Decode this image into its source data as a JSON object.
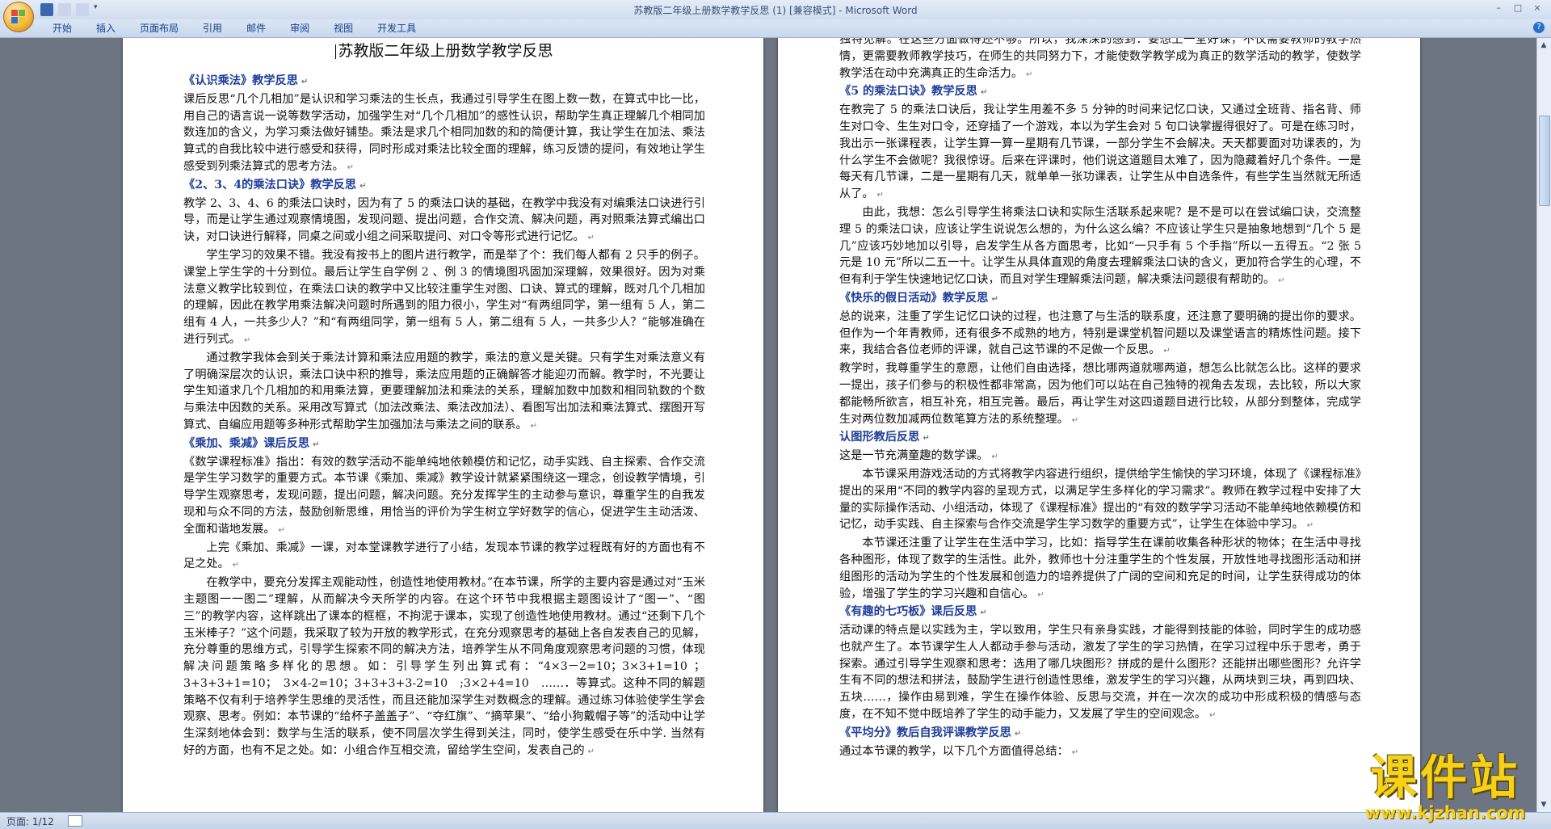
{
  "window": {
    "title": "苏教版二年级上册数学教学反思 (1) [兼容模式] - Microsoft Word",
    "controls": [
      "–",
      "□",
      "×"
    ]
  },
  "ribbon": {
    "tabs": [
      "开始",
      "插入",
      "页面布局",
      "引用",
      "邮件",
      "审阅",
      "视图",
      "开发工具"
    ]
  },
  "status": {
    "page": "页面: 1/12"
  },
  "watermark": {
    "title": "课件站",
    "url": "www.kjzhan.com"
  },
  "page1": {
    "title": "苏教版二年级上册数学教学反思",
    "blocks": [
      {
        "type": "h",
        "text": "《认识乘法》教学反思"
      },
      {
        "type": "p",
        "text": "课后反思“几个几相加”是认识和学习乘法的生长点，我通过引导学生在图上数一数，在算式中比一比，用自己的语言说一说等数学活动，加强学生对“几个几相加”的感性认识，帮助学生真正理解几个相同加数连加的含义，为学习乘法做好铺垫。乘法是求几个相同加数的和的简便计算，我让学生在加法、乘法算式的自我比较中进行感受和获得，同时形成对乘法比较全面的理解，练习反馈的提问，有效地让学生感受到列乘法算式的思考方法。"
      },
      {
        "type": "h",
        "text": "《2、3、4的乘法口诀》教学反思"
      },
      {
        "type": "p",
        "text": "教学 2、3、4、6 的乘法口诀时，因为有了 5 的乘法口诀的基础，在教学中我没有对编乘法口诀进行引导，而是让学生通过观察情境图，发现问题、提出问题，合作交流、解决问题，再对照乘法算式编出口诀，对口诀进行解释，同桌之间或小组之间采取提问、对口令等形式进行记忆。"
      },
      {
        "type": "pi",
        "text": "学生学习的效果不错。我没有按书上的图片进行教学，而是举了个：我们每人都有 2 只手的例子。课堂上学生学的十分到位。最后让学生自学例 2 、例 3 的情境图巩固加深理解，效果很好。因为对乘法意义教学比较到位，在乘法口诀的教学中又比较注重学生对图、口诀、算式的理解，既对几个几相加的理解，因此在教学用乘法解决问题时所遇到的阻力很小，学生对“有两组同学，第一组有 5 人，第二组有 4 人，一共多少人？”和“有两组同学，第一组有 5 人，第二组有 5 人，一共多少人？”能够准确在进行列式。"
      },
      {
        "type": "pi",
        "text": "通过教学我体会到关于乘法计算和乘法应用题的教学，乘法的意义是关键。只有学生对乘法意义有了明确深层次的认识，乘法口诀中积的推导，乘法应用题的正确解答才能迎刃而解。教学时，不光要让学生知道求几个几相加的和用乘法算，更要理解加法和乘法的关系，理解加数中加数和相同轨数的个数与乘法中因数的关系。采用改写算式（加法改乘法、乘法改加法）、看图写出加法和乘法算式、摆图开写算式、自编应用题等多种形式帮助学生加强加法与乘法之间的联系。"
      },
      {
        "type": "h",
        "text": "《乘加、乘减》课后反思"
      },
      {
        "type": "p",
        "text": "《数学课程标准》指出：有效的数学活动不能单纯地依赖模仿和记忆，动手实践、自主探索、合作交流是学生学习数学的重要方式。本节课《乘加、乘减》教学设计就紧紧围绕这一理念，创设教学情境，引导学生观察思考，发现问题，提出问题，解决问题。充分发挥学生的主动参与意识，尊重学生的自我发现和与众不同的方法，鼓励创新思维，用恰当的评价为学生树立学好数学的信心，促进学生主动活泼、全面和谐地发展。"
      },
      {
        "type": "pi",
        "text": "上完《乘加、乘减》一课，对本堂课教学进行了小结，发现本节课的教学过程既有好的方面也有不足之处。"
      },
      {
        "type": "pi",
        "text": "在教学中，要充分发挥主观能动性，创造性地使用教材。”在本节课，所学的主要内容是通过对“玉米主题图一一图二”理解，从而解决今天所学的内容。在这个环节中我根据主题图设计了“图一”、“图三”的教学内容，这样跳出了课本的框框，不拘泥于课本，实现了创造性地使用教材。通过“还剩下几个玉米棒子？”这个问题，我采取了较为开放的教学形式，在充分观察思考的基础上各自发表自己的见解，充分尊重的思维方式，引导学生探索不同的解决方法，培养学生从不同角度观察思考问题的习惯，体现解决问题策略多样化的思想。如：引导学生列出算式有：“4×3－2=10；3×3+1=10 ；3+3+3+1=10；　3×4-2=10；3+3+3+3-2=10　;3×2+4=10　……．等算式。这种不同的解题策略不仅有利于培养学生思维的灵活性，而且还能加深学生对数概念的理解。通过练习体验使学生学会观察、思考。例如：本节课的“给杯子盖盖子”、“夺红旗”、“摘苹果”、“给小狗戴帽子等”的活动中让学生深刻地体会到：数学与生活的联系，使不同层次学生得到关注，同时，使学生感受在乐中学. 当然有好的方面，也有不足之处。如：小组合作互相交流，留给学生空间，发表自己的"
      }
    ]
  },
  "page2": {
    "blocks": [
      {
        "type": "p",
        "text": "独特见解。在这些方面做得还不够。所以，我深深的感到：要想上一堂好课，不仅需要教师的教学热情，更需要教师教学技巧，在师生的共同努力下，才能使数学教学成为真正的数学活动的教学，使数学教学活在动中充满真正的生命活力。"
      },
      {
        "type": "h",
        "text": "《5 的乘法口诀》教学反思"
      },
      {
        "type": "p",
        "text": "在教完了 5 的乘法口诀后，我让学生用差不多 5 分钟的时间来记忆口诀，又通过全班背、指名背、师生对口令、生生对口令，还穿插了一个游戏，本以为学生会对 5 句口诀掌握得很好了。可是在练习时，我出示一张课程表，让学生算一算一星期有几节课，一部分学生不会解决。天天都要面对功课表的，为什么学生不会做呢？我很惊讶。后来在评课时，他们说这道题目太难了，因为隐藏着好几个条件。一是每天有几节课，二是一星期有几天，就单单一张功课表，让学生从中自选条件，有些学生当然就无所适从了。"
      },
      {
        "type": "pi",
        "text": "由此，我想：怎么引导学生将乘法口诀和实际生活联系起来呢？是不是可以在尝试编口诀，交流整理 5 的乘法口诀，应该让学生说说怎么想的，为什么这么编？不应该让学生只是抽象地想到“几个 5 是几”应该巧妙地加以引导，启发学生从各方面思考，比如“一只手有 5 个手指”所以一五得五。“2 张 5 元是 10 元”所以二五一十。让学生从具体直观的角度去理解乘法口诀的含义，更加符合学生的心理，不但有利于学生快速地记忆口诀，而且对学生理解乘法问题，解决乘法问题很有帮助的。"
      },
      {
        "type": "h",
        "text": "《快乐的假日活动》教学反思"
      },
      {
        "type": "p",
        "text": "总的说来，注重了学生记忆口诀的过程，也注意了与生活的联系度，还注意了要明确的提出你的要求。但作为一个年青教师，还有很多不成熟的地方，特别是课堂机智问题以及课堂语言的精炼性问题。接下来，我结合各位老师的评课，就自己这节课的不足做一个反思。"
      },
      {
        "type": "p",
        "text": "教学时，我尊重学生的意愿，让他们自由选择，想比哪两道就哪两道，想怎么比就怎么比。这样的要求一提出，孩子们参与的积极性都非常高，因为他们可以站在自己独特的视角去发现，去比较，所以大家都能畅所欲言，相互补充，相互完善。最后，再让学生对这四道题目进行比较，从部分到整体，完成学生对两位数加减两位数笔算方法的系统整理。"
      },
      {
        "type": "h",
        "text": "认图形教后反思"
      },
      {
        "type": "p",
        "text": "这是一节充满童趣的数学课。"
      },
      {
        "type": "pi",
        "text": "本节课采用游戏活动的方式将教学内容进行组织，提供给学生愉快的学习环境，体现了《课程标准》提出的采用“不同的教学内容的呈现方式，以满足学生多样化的学习需求”。教师在教学过程中安排了大量的实际操作活动、小组活动，体现了《课程标准》提出的“有效的数学学习活动不能单纯地依赖模仿和记忆，动手实践、自主探索与合作交流是学生学习数学的重要方式”，让学生在体验中学习。"
      },
      {
        "type": "pi",
        "text": "本节课还注重了让学生在生活中学习，比如：指导学生在课前收集各种形状的物体；在生活中寻找各种图形，体现了数学的生活性。此外，教师也十分注重学生的个性发展，开放性地寻找图形活动和拼组图形的活动为学生的个性发展和创造力的培养提供了广阔的空间和充足的时间，让学生获得成功的体验，增强了学生的学习兴趣和自信心。"
      },
      {
        "type": "h",
        "text": "《有趣的七巧板》课后反思"
      },
      {
        "type": "p",
        "text": "活动课的特点是以实践为主，学以致用，学生只有亲身实践，才能得到技能的体验，同时学生的成功感也就产生了。本节课学生人人都动手参与活动，激发了学生的学习热情，在学习过程中乐于思考，勇于探索。通过引导学生观察和思考：选用了哪几块图形？拼成的是什么图形？还能拼出哪些图形？允许学生有不同的想法和拼法，鼓励学生进行创造性思维，激发学生的学习兴趣，从两块到三块，再到四块、五块……，操作由易到难，学生在操作体验、反思与交流，并在一次次的成功中形成积极的情感与态度，在不知不觉中既培养了学生的动手能力，又发展了学生的空间观念。"
      },
      {
        "type": "h",
        "text": "《平均分》教后自我评课教学反思"
      },
      {
        "type": "p",
        "text": "通过本节课的教学，以下几个方面值得总结："
      }
    ]
  }
}
